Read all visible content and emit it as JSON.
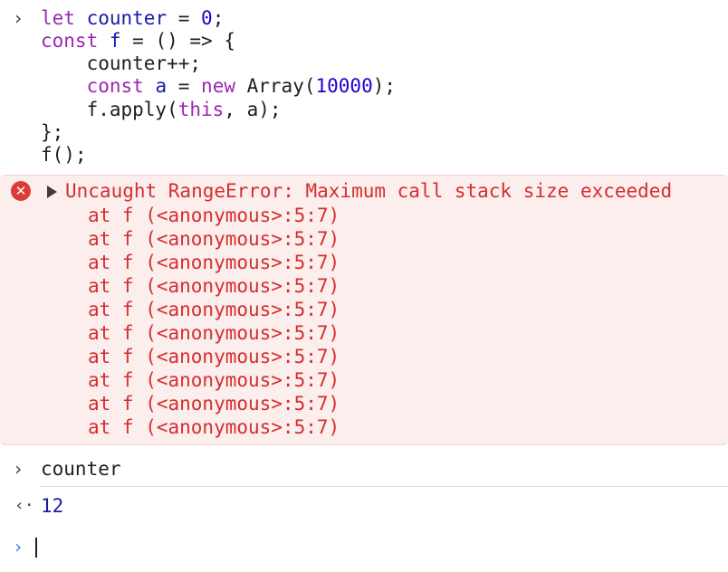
{
  "input_block": {
    "prompt_symbol": "›",
    "lines": [
      [
        {
          "t": "let",
          "c": "kw"
        },
        {
          "t": " ",
          "c": "plain"
        },
        {
          "t": "counter",
          "c": "var"
        },
        {
          "t": " = ",
          "c": "plain"
        },
        {
          "t": "0",
          "c": "num"
        },
        {
          "t": ";",
          "c": "plain"
        }
      ],
      [
        {
          "t": "const",
          "c": "kw"
        },
        {
          "t": " ",
          "c": "plain"
        },
        {
          "t": "f",
          "c": "var"
        },
        {
          "t": " = () => {",
          "c": "plain"
        }
      ],
      [
        {
          "t": "    counter++;",
          "c": "plain"
        }
      ],
      [
        {
          "t": "    ",
          "c": "plain"
        },
        {
          "t": "const",
          "c": "kw"
        },
        {
          "t": " ",
          "c": "plain"
        },
        {
          "t": "a",
          "c": "var"
        },
        {
          "t": " = ",
          "c": "plain"
        },
        {
          "t": "new",
          "c": "kw"
        },
        {
          "t": " Array(",
          "c": "plain"
        },
        {
          "t": "10000",
          "c": "num"
        },
        {
          "t": ");",
          "c": "plain"
        }
      ],
      [
        {
          "t": "    f.apply(",
          "c": "plain"
        },
        {
          "t": "this",
          "c": "kw"
        },
        {
          "t": ", a);",
          "c": "plain"
        }
      ],
      [
        {
          "t": "};",
          "c": "plain"
        }
      ],
      [
        {
          "t": "f();",
          "c": "plain"
        }
      ]
    ]
  },
  "error": {
    "icon_symbol": "✕",
    "message": "Uncaught RangeError: Maximum call stack size exceeded",
    "stack": [
      "at f (<anonymous>:5:7)",
      "at f (<anonymous>:5:7)",
      "at f (<anonymous>:5:7)",
      "at f (<anonymous>:5:7)",
      "at f (<anonymous>:5:7)",
      "at f (<anonymous>:5:7)",
      "at f (<anonymous>:5:7)",
      "at f (<anonymous>:5:7)",
      "at f (<anonymous>:5:7)",
      "at f (<anonymous>:5:7)"
    ]
  },
  "second_input": {
    "prompt_symbol": "›",
    "text": "counter"
  },
  "result": {
    "arrow_symbol": "‹·",
    "value": "12"
  },
  "active_prompt": {
    "prompt_symbol": "›"
  },
  "colors": {
    "keyword": "#9c27b0",
    "variable": "#1a1aa6",
    "number": "#1c00cf",
    "error_text": "#d32f2f",
    "error_background": "#fceeed",
    "error_icon": "#dc3c35",
    "active_prompt": "#4a7de8"
  }
}
